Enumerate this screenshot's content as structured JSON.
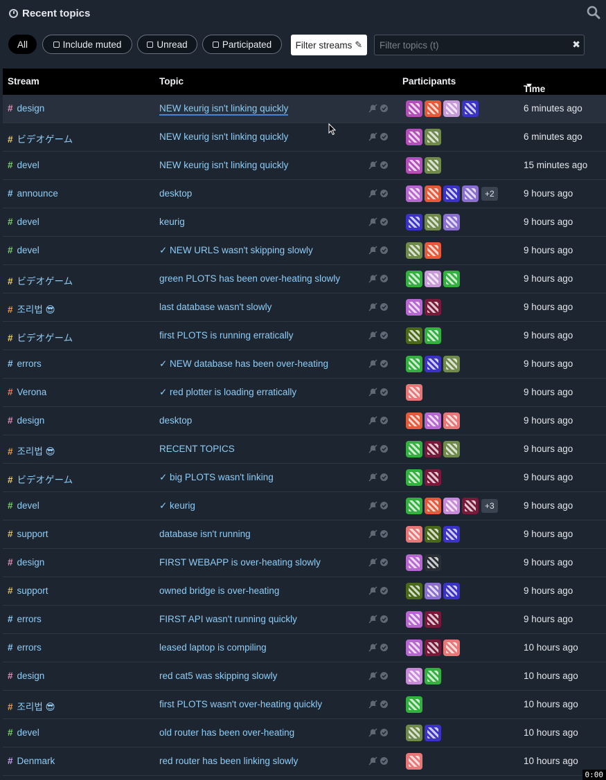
{
  "header": {
    "title": "Recent topics"
  },
  "filters": {
    "all": "All",
    "include_muted": "Include muted",
    "unread": "Unread",
    "participated": "Participated",
    "filter_streams": "Filter streams",
    "topic_placeholder": "Filter topics (t)"
  },
  "columns": {
    "stream": "Stream",
    "topic": "Topic",
    "participants": "Participants",
    "time": "Time"
  },
  "timer": "0:00",
  "rows": [
    {
      "stream": "design",
      "hash_color": "#e58fb8",
      "topic": "NEW keurig isn't linking quickly",
      "avatars": [
        "#b24fb8",
        "#e45a3a",
        "#c79ad8",
        "#3b32c8"
      ],
      "extra": "",
      "time": "6 minutes ago"
    },
    {
      "stream": "ビデオゲーム",
      "hash_color": "#f0d060",
      "topic": "NEW keurig isn't linking quickly",
      "avatars": [
        "#b24fb8",
        "#6f8a4a"
      ],
      "extra": "",
      "time": "6 minutes ago"
    },
    {
      "stream": "devel",
      "hash_color": "#7cd16b",
      "topic": "NEW keurig isn't linking quickly",
      "avatars": [
        "#b24fb8",
        "#6f8a4a"
      ],
      "extra": "",
      "time": "15 minutes ago"
    },
    {
      "stream": "announce",
      "hash_color": "#8fcdf6",
      "topic": "desktop",
      "avatars": [
        "#b767d0",
        "#e45a3a",
        "#3b32c8",
        "#8a6fd0"
      ],
      "extra": "+2",
      "time": "9 hours ago"
    },
    {
      "stream": "devel",
      "hash_color": "#7cd16b",
      "topic": "keurig",
      "avatars": [
        "#3b32c8",
        "#6f8a4a",
        "#8a6fd0"
      ],
      "extra": "",
      "time": "9 hours ago"
    },
    {
      "stream": "devel",
      "hash_color": "#7cd16b",
      "topic": "✓ NEW URLS wasn't skipping slowly",
      "avatars": [
        "#6f8a4a",
        "#e45a3a"
      ],
      "extra": "",
      "time": "9 hours ago"
    },
    {
      "stream": "ビデオゲーム",
      "hash_color": "#f0d060",
      "topic": "green PLOTS has been over-heating slowly",
      "avatars": [
        "#33b040",
        "#c79ad8",
        "#33b040"
      ],
      "extra": "",
      "time": "9 hours ago"
    },
    {
      "stream": "조리법 😎",
      "hash_color": "#f0a040",
      "topic": "last database wasn't slowly",
      "avatars": [
        "#b767d0",
        "#7a1a3a"
      ],
      "extra": "",
      "time": "9 hours ago"
    },
    {
      "stream": "ビデオゲーム",
      "hash_color": "#f0d060",
      "topic": "first PLOTS is running erratically",
      "avatars": [
        "#4a6a1a",
        "#33b040"
      ],
      "extra": "",
      "time": "9 hours ago"
    },
    {
      "stream": "errors",
      "hash_color": "#8fcdf6",
      "topic": "✓ NEW database has been over-heating",
      "avatars": [
        "#33b040",
        "#3b32c8",
        "#6f8a4a"
      ],
      "extra": "",
      "time": "9 hours ago"
    },
    {
      "stream": "Verona",
      "hash_color": "#f08060",
      "topic": "✓ red plotter is loading erratically",
      "avatars": [
        "#e87878"
      ],
      "extra": "",
      "time": "9 hours ago"
    },
    {
      "stream": "design",
      "hash_color": "#e58fb8",
      "topic": "desktop",
      "avatars": [
        "#e45a3a",
        "#b767d0",
        "#e87878"
      ],
      "extra": "",
      "time": "9 hours ago"
    },
    {
      "stream": "조리법 😎",
      "hash_color": "#f0a040",
      "topic": "RECENT TOPICS",
      "avatars": [
        "#33b040",
        "#7a1a3a",
        "#6f8a4a"
      ],
      "extra": "",
      "time": "9 hours ago"
    },
    {
      "stream": "ビデオゲーム",
      "hash_color": "#f0d060",
      "topic": "✓ big PLOTS wasn't linking",
      "avatars": [
        "#33b040",
        "#7a1a3a"
      ],
      "extra": "",
      "time": "9 hours ago"
    },
    {
      "stream": "devel",
      "hash_color": "#7cd16b",
      "topic": "✓ keurig",
      "avatars": [
        "#33b040",
        "#e45a3a",
        "#c78ad8",
        "#7a1a3a"
      ],
      "extra": "+3",
      "time": "9 hours ago"
    },
    {
      "stream": "support",
      "hash_color": "#e0c060",
      "topic": "database isn't running",
      "avatars": [
        "#e87878",
        "#4a6a1a",
        "#3b32c8"
      ],
      "extra": "",
      "time": "9 hours ago"
    },
    {
      "stream": "design",
      "hash_color": "#e58fb8",
      "topic": "FIRST WEBAPP is over-heating slowly",
      "avatars": [
        "#b767d0",
        "#2a2f36"
      ],
      "extra": "",
      "time": "9 hours ago"
    },
    {
      "stream": "support",
      "hash_color": "#e0c060",
      "topic": "owned bridge is over-heating",
      "avatars": [
        "#4a6a1a",
        "#8a6fd0",
        "#3b32c8"
      ],
      "extra": "",
      "time": "9 hours ago"
    },
    {
      "stream": "errors",
      "hash_color": "#8fcdf6",
      "topic": "FIRST API wasn't running quickly",
      "avatars": [
        "#b767d0",
        "#7a1a3a"
      ],
      "extra": "",
      "time": "9 hours ago"
    },
    {
      "stream": "errors",
      "hash_color": "#8fcdf6",
      "topic": "leased laptop is compiling",
      "avatars": [
        "#b767d0",
        "#7a1a3a",
        "#e87878"
      ],
      "extra": "",
      "time": "10 hours ago"
    },
    {
      "stream": "design",
      "hash_color": "#e58fb8",
      "topic": "red cat5 was skipping slowly",
      "avatars": [
        "#c78ad8",
        "#33b040"
      ],
      "extra": "",
      "time": "10 hours ago"
    },
    {
      "stream": "조리법 😎",
      "hash_color": "#f0a040",
      "topic": "first PLOTS wasn't over-heating quickly",
      "avatars": [
        "#33b040"
      ],
      "extra": "",
      "time": "10 hours ago"
    },
    {
      "stream": "devel",
      "hash_color": "#7cd16b",
      "topic": "old router has been over-heating",
      "avatars": [
        "#6f8a4a",
        "#3b32c8"
      ],
      "extra": "",
      "time": "10 hours ago"
    },
    {
      "stream": "Denmark",
      "hash_color": "#c9a0f0",
      "topic": "red router has been linking slowly",
      "avatars": [
        "#e87878"
      ],
      "extra": "",
      "time": "10 hours ago"
    }
  ]
}
